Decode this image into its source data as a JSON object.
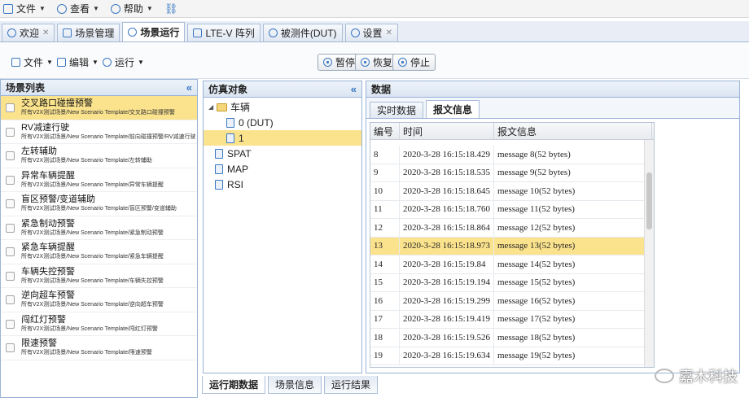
{
  "menubar": {
    "items": [
      {
        "label": "文件",
        "icon": "file-icon"
      },
      {
        "label": "查看",
        "icon": "view-icon"
      },
      {
        "label": "帮助",
        "icon": "help-icon"
      }
    ]
  },
  "tabs": [
    {
      "label": "欢迎",
      "closable": true
    },
    {
      "label": "场景管理",
      "closable": false
    },
    {
      "label": "场景运行",
      "closable": false,
      "active": true
    },
    {
      "label": "LTE-V 阵列",
      "closable": false
    },
    {
      "label": "被测件(DUT)",
      "closable": false
    },
    {
      "label": "设置",
      "closable": true
    }
  ],
  "toolbar": {
    "file_label": "文件",
    "edit_label": "编辑",
    "run_label": "运行",
    "pause_label": "暂停",
    "resume_label": "恢复",
    "stop_label": "停止"
  },
  "scenario_list": {
    "title": "场景列表",
    "items": [
      {
        "name": "交叉路口碰撞预警",
        "path": "所有V2X测试场景/New Scenario Template/交叉路口碰撞预警",
        "selected": true
      },
      {
        "name": "RV减速行驶",
        "path": "所有V2X测试场景/New Scenario Template/前向碰撞预警/RV减速行驶"
      },
      {
        "name": "左转辅助",
        "path": "所有V2X测试场景/New Scenario Template/左转辅助"
      },
      {
        "name": "异常车辆提醒",
        "path": "所有V2X测试场景/New Scenario Template/异常车辆提醒"
      },
      {
        "name": "盲区预警/变道辅助",
        "path": "所有V2X测试场景/New Scenario Template/盲区预警/变道辅助"
      },
      {
        "name": "紧急制动预警",
        "path": "所有V2X测试场景/New Scenario Template/紧急制动预警"
      },
      {
        "name": "紧急车辆提醒",
        "path": "所有V2X测试场景/New Scenario Template/紧急车辆提醒"
      },
      {
        "name": "车辆失控预警",
        "path": "所有V2X测试场景/New Scenario Template/车辆失控预警"
      },
      {
        "name": "逆向超车预警",
        "path": "所有V2X测试场景/New Scenario Template/逆向超车预警"
      },
      {
        "name": "闯红灯预警",
        "path": "所有V2X测试场景/New Scenario Template/闯红灯预警"
      },
      {
        "name": "限速预警",
        "path": "所有V2X测试场景/New Scenario Template/限速预警"
      }
    ]
  },
  "sim_objects": {
    "title": "仿真对象",
    "root": "车辆",
    "children": [
      "0 (DUT)",
      "1"
    ],
    "others": [
      "SPAT",
      "MAP",
      "RSI"
    ]
  },
  "data_panel": {
    "title": "数据",
    "subtabs": [
      "实时数据",
      "报文信息"
    ],
    "columns": [
      "编号",
      "时间",
      "报文信息"
    ],
    "rows": [
      {
        "id": "8",
        "time": "2020-3-28 16:15:18.429",
        "msg": "message 8(52 bytes)"
      },
      {
        "id": "9",
        "time": "2020-3-28 16:15:18.535",
        "msg": "message 9(52 bytes)"
      },
      {
        "id": "10",
        "time": "2020-3-28 16:15:18.645",
        "msg": "message 10(52 bytes)"
      },
      {
        "id": "11",
        "time": "2020-3-28 16:15:18.760",
        "msg": "message 11(52 bytes)"
      },
      {
        "id": "12",
        "time": "2020-3-28 16:15:18.864",
        "msg": "message 12(52 bytes)"
      },
      {
        "id": "13",
        "time": "2020-3-28 16:15:18.973",
        "msg": "message 13(52 bytes)",
        "selected": true
      },
      {
        "id": "14",
        "time": "2020-3-28 16:15:19.84",
        "msg": "message 14(52 bytes)"
      },
      {
        "id": "15",
        "time": "2020-3-28 16:15:19.194",
        "msg": "message 15(52 bytes)"
      },
      {
        "id": "16",
        "time": "2020-3-28 16:15:19.299",
        "msg": "message 16(52 bytes)"
      },
      {
        "id": "17",
        "time": "2020-3-28 16:15:19.419",
        "msg": "message 17(52 bytes)"
      },
      {
        "id": "18",
        "time": "2020-3-28 16:15:19.526",
        "msg": "message 18(52 bytes)"
      },
      {
        "id": "19",
        "time": "2020-3-28 16:15:19.634",
        "msg": "message 19(52 bytes)"
      }
    ]
  },
  "bottom_tabs": [
    "运行期数据",
    "场景信息",
    "运行结果"
  ],
  "watermark": "嘉木科技",
  "colors": {
    "selected": "#fbe38e",
    "accent": "#3a78c2",
    "border": "#99b3d6"
  }
}
